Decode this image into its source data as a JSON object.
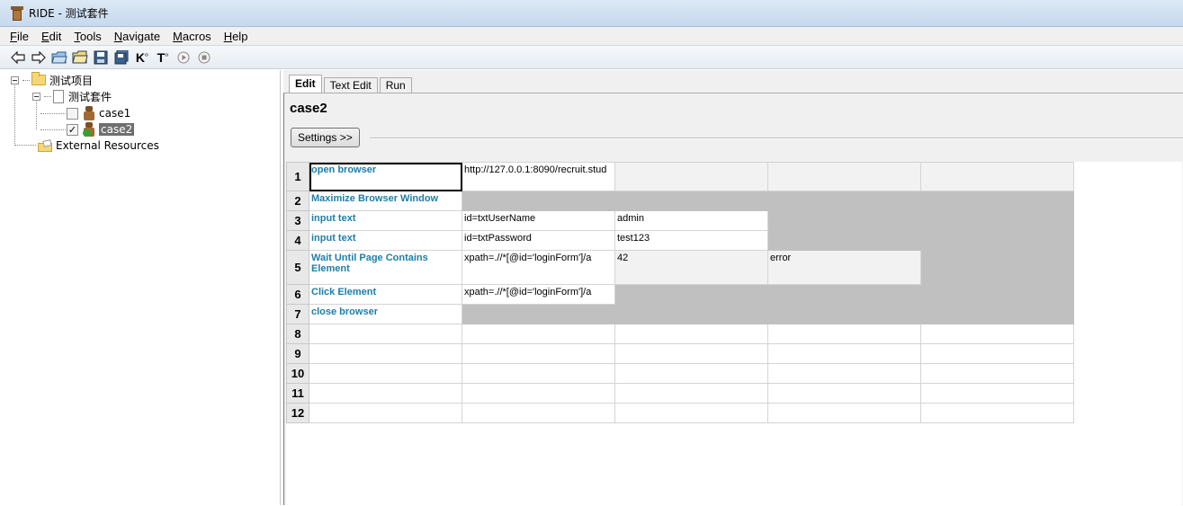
{
  "window": {
    "title": "RIDE - 测试套件"
  },
  "menu": [
    {
      "label": "File",
      "u": "F",
      "rest": "ile"
    },
    {
      "label": "Edit",
      "u": "E",
      "rest": "dit"
    },
    {
      "label": "Tools",
      "u": "T",
      "rest": "ools"
    },
    {
      "label": "Navigate",
      "u": "N",
      "rest": "avigate"
    },
    {
      "label": "Macros",
      "u": "M",
      "rest": "acros"
    },
    {
      "label": "Help",
      "u": "H",
      "rest": "elp"
    }
  ],
  "toolbar": {
    "buttons": [
      "back-arrow-icon",
      "forward-arrow-icon",
      "open-suite-icon",
      "open-directory-icon",
      "save-icon",
      "save-all-icon",
      "search-keywords-icon",
      "search-tests-icon",
      "run-icon",
      "stop-icon"
    ],
    "glyphs": {
      "keywords": "K",
      "tests": "T"
    }
  },
  "tree": {
    "project": "测试项目",
    "suite": "测试套件",
    "cases": [
      {
        "label": "case1",
        "checked": false,
        "selected": false,
        "check_glyph": ""
      },
      {
        "label": "case2",
        "checked": true,
        "selected": true,
        "check_glyph": "✓"
      }
    ],
    "external": "External Resources"
  },
  "tabs": [
    {
      "label": "Edit",
      "active": true
    },
    {
      "label": "Text Edit",
      "active": false
    },
    {
      "label": "Run",
      "active": false
    }
  ],
  "editor": {
    "case_title": "case2",
    "settings_label": "Settings >>"
  },
  "grid": {
    "rows": [
      {
        "num": "1",
        "cells": [
          "open browser",
          "http://127.0.0.1:8090/recruit.stud",
          "",
          "",
          ""
        ],
        "style": [
          "kw sel",
          "",
          "lightgray",
          "lightgray",
          "lightgray"
        ]
      },
      {
        "num": "2",
        "cells": [
          "Maximize Browser Window",
          "",
          "",
          "",
          ""
        ],
        "style": [
          "kw",
          "gray",
          "gray",
          "gray",
          "gray"
        ]
      },
      {
        "num": "3",
        "cells": [
          "input text",
          "id=txtUserName",
          "admin",
          "",
          ""
        ],
        "style": [
          "kw",
          "",
          "",
          "gray",
          "gray"
        ]
      },
      {
        "num": "4",
        "cells": [
          "input text",
          "id=txtPassword",
          "test123",
          "",
          ""
        ],
        "style": [
          "kw",
          "",
          "",
          "gray",
          "gray"
        ]
      },
      {
        "num": "5",
        "cells": [
          "Wait Until Page Contains Element",
          "xpath=.//*[@id='loginForm']/a",
          "42",
          "error",
          ""
        ],
        "style": [
          "kw",
          "",
          "lightgray",
          "lightgray",
          "gray"
        ]
      },
      {
        "num": "6",
        "cells": [
          "Click Element",
          "xpath=.//*[@id='loginForm']/a",
          "",
          "",
          ""
        ],
        "style": [
          "kw",
          "",
          "gray",
          "gray",
          "gray"
        ]
      },
      {
        "num": "7",
        "cells": [
          "close browser",
          "",
          "",
          "",
          ""
        ],
        "style": [
          "kw",
          "gray",
          "gray",
          "gray",
          "gray"
        ]
      },
      {
        "num": "8",
        "cells": [
          "",
          "",
          "",
          "",
          ""
        ],
        "style": [
          "",
          "",
          "",
          "",
          ""
        ]
      },
      {
        "num": "9",
        "cells": [
          "",
          "",
          "",
          "",
          ""
        ],
        "style": [
          "",
          "",
          "",
          "",
          ""
        ]
      },
      {
        "num": "10",
        "cells": [
          "",
          "",
          "",
          "",
          ""
        ],
        "style": [
          "",
          "",
          "",
          "",
          ""
        ]
      },
      {
        "num": "11",
        "cells": [
          "",
          "",
          "",
          "",
          ""
        ],
        "style": [
          "",
          "",
          "",
          "",
          ""
        ]
      },
      {
        "num": "12",
        "cells": [
          "",
          "",
          "",
          "",
          ""
        ],
        "style": [
          "",
          "",
          "",
          "",
          ""
        ]
      }
    ]
  },
  "colors": {
    "keyword": "#1d7ea8",
    "inactive_cell": "#c0c0c0",
    "selection": "#6f6f6f"
  }
}
